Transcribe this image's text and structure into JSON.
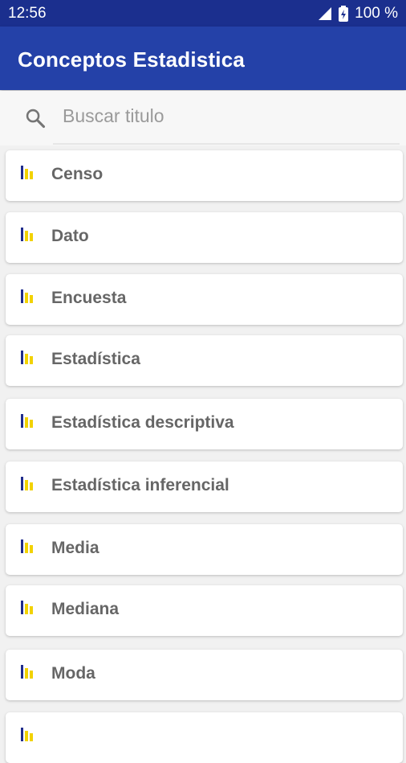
{
  "status_bar": {
    "time": "12:56",
    "battery": "100 %"
  },
  "app_bar": {
    "title": "Conceptos Estadistica"
  },
  "search": {
    "placeholder": "Buscar titulo",
    "value": ""
  },
  "icons": {
    "search": "search-icon",
    "item": "bar-chart-icon",
    "signal": "signal-icon",
    "battery": "battery-icon"
  },
  "colors": {
    "status_bar": "#1b2f8e",
    "app_bar": "#2441a8",
    "icon_blue": "#1f2c8c",
    "icon_yellow": "#f2d200"
  },
  "list": {
    "items": [
      {
        "label": "Censo"
      },
      {
        "label": "Dato"
      },
      {
        "label": "Encuesta"
      },
      {
        "label": "Estadística"
      },
      {
        "label": "Estadística descriptiva"
      },
      {
        "label": "Estadística inferencial"
      },
      {
        "label": "Media"
      },
      {
        "label": "Mediana"
      },
      {
        "label": "Moda"
      },
      {
        "label": ""
      }
    ]
  }
}
